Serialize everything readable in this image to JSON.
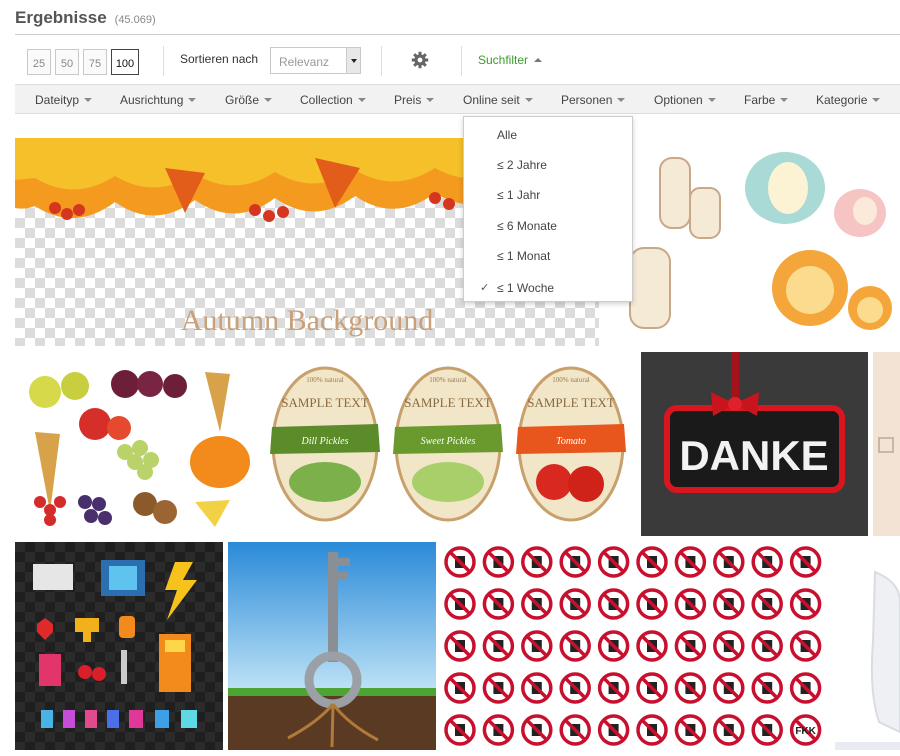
{
  "header": {
    "title": "Ergebnisse",
    "count": "(45.069)"
  },
  "toolbar": {
    "per_page": [
      "25",
      "50",
      "75",
      "100"
    ],
    "per_page_active": "100",
    "sort_label": "Sortieren nach",
    "sort_value": "Relevanz",
    "settings_icon": "gear-icon",
    "filter_toggle": "Suchfilter"
  },
  "filters": [
    "Dateityp",
    "Ausrichtung",
    "Größe",
    "Collection",
    "Preis",
    "Online seit",
    "Personen",
    "Optionen",
    "Farbe",
    "Kategorie"
  ],
  "dropdown": {
    "items": [
      "Alle",
      "≤ 2 Jahre",
      "≤ 1 Jahr",
      "≤ 6 Monate",
      "≤ 1 Monat",
      "≤ 1 Woche"
    ],
    "selected": "≤ 1 Woche",
    "check_mark": "✓"
  },
  "results": {
    "autumn": "Autumn Background",
    "labels": [
      {
        "top": "100% natural",
        "main": "SAMPLE TEXT",
        "ribbon": "Dill Pickles"
      },
      {
        "top": "100% natural",
        "main": "SAMPLE TEXT",
        "ribbon": "Sweet Pickles"
      },
      {
        "top": "100% natural",
        "main": "SAMPLE TEXT",
        "ribbon": "Tomato"
      }
    ],
    "danke": "DANKE",
    "sign_last_text": "FKK",
    "colors": {
      "accent": "#3c9a2b",
      "sign_red": "#c8102e"
    }
  }
}
